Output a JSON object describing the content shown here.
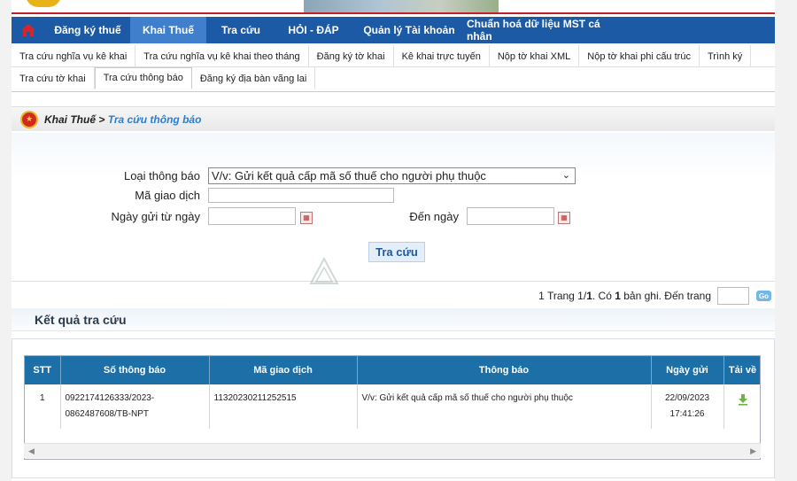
{
  "nav": {
    "items": [
      "Đăng ký thuế",
      "Khai Thuế",
      "Tra cứu",
      "HỎI - ĐÁP",
      "Quản lý Tài khoản",
      "Chuẩn hoá dữ liệu MST cá nhân"
    ],
    "active_index": 1
  },
  "subtabs": {
    "row1": [
      "Tra cứu nghĩa vụ kê khai",
      "Tra cứu nghĩa vụ kê khai theo tháng",
      "Đăng ký tờ khai",
      "Kê khai trực tuyến",
      "Nộp tờ khai XML",
      "Nộp tờ khai phi cấu trúc",
      "Trình ký"
    ],
    "row2": [
      "Tra cứu tờ khai",
      "Tra cứu thông báo",
      "Đăng ký địa bàn vãng lai"
    ],
    "active": "Tra cứu thông báo"
  },
  "breadcrumb": {
    "section": "Khai Thuế",
    "separator": ">",
    "current": "Tra cứu thông báo"
  },
  "form": {
    "loai_thong_bao_label": "Loại thông báo",
    "loai_thong_bao_value": "V/v: Gửi kết quả cấp mã số thuế cho người phụ thuộc",
    "ma_giao_dich_label": "Mã giao dịch",
    "ma_giao_dich_value": "",
    "ngay_gui_tu_label": "Ngày gửi từ ngày",
    "den_ngay_label": "Đến ngày",
    "search_button": "Tra cứu"
  },
  "pager": {
    "text_prefix": "1  Trang 1/",
    "pages": "1",
    "text_mid": ". Có ",
    "records": "1",
    "text_suffix": " bản ghi. Đến trang",
    "go": "Go"
  },
  "results": {
    "title": "Kết quả tra cứu",
    "columns": [
      "STT",
      "Số thông báo",
      "Mã giao dịch",
      "Thông báo",
      "Ngày gửi",
      "Tải về"
    ],
    "rows": [
      {
        "stt": "1",
        "so_thong_bao_1": "0922174126333/2023-",
        "so_thong_bao_2": "0862487608/TB-NPT",
        "ma_giao_dich": "11320230211252515",
        "thong_bao": "V/v: Gửi kết quả cấp mã số thuế cho người phụ thuộc",
        "ngay_gui_date": "22/09/2023",
        "ngay_gui_time": "17:41:26",
        "download_icon": "download-icon"
      }
    ]
  },
  "colors": {
    "nav_bg": "#1d5aa6",
    "nav_active": "#3f7fcb",
    "table_header": "#1d6fa8",
    "link_blue": "#2a7fd0",
    "red_accent": "#c0202a"
  }
}
